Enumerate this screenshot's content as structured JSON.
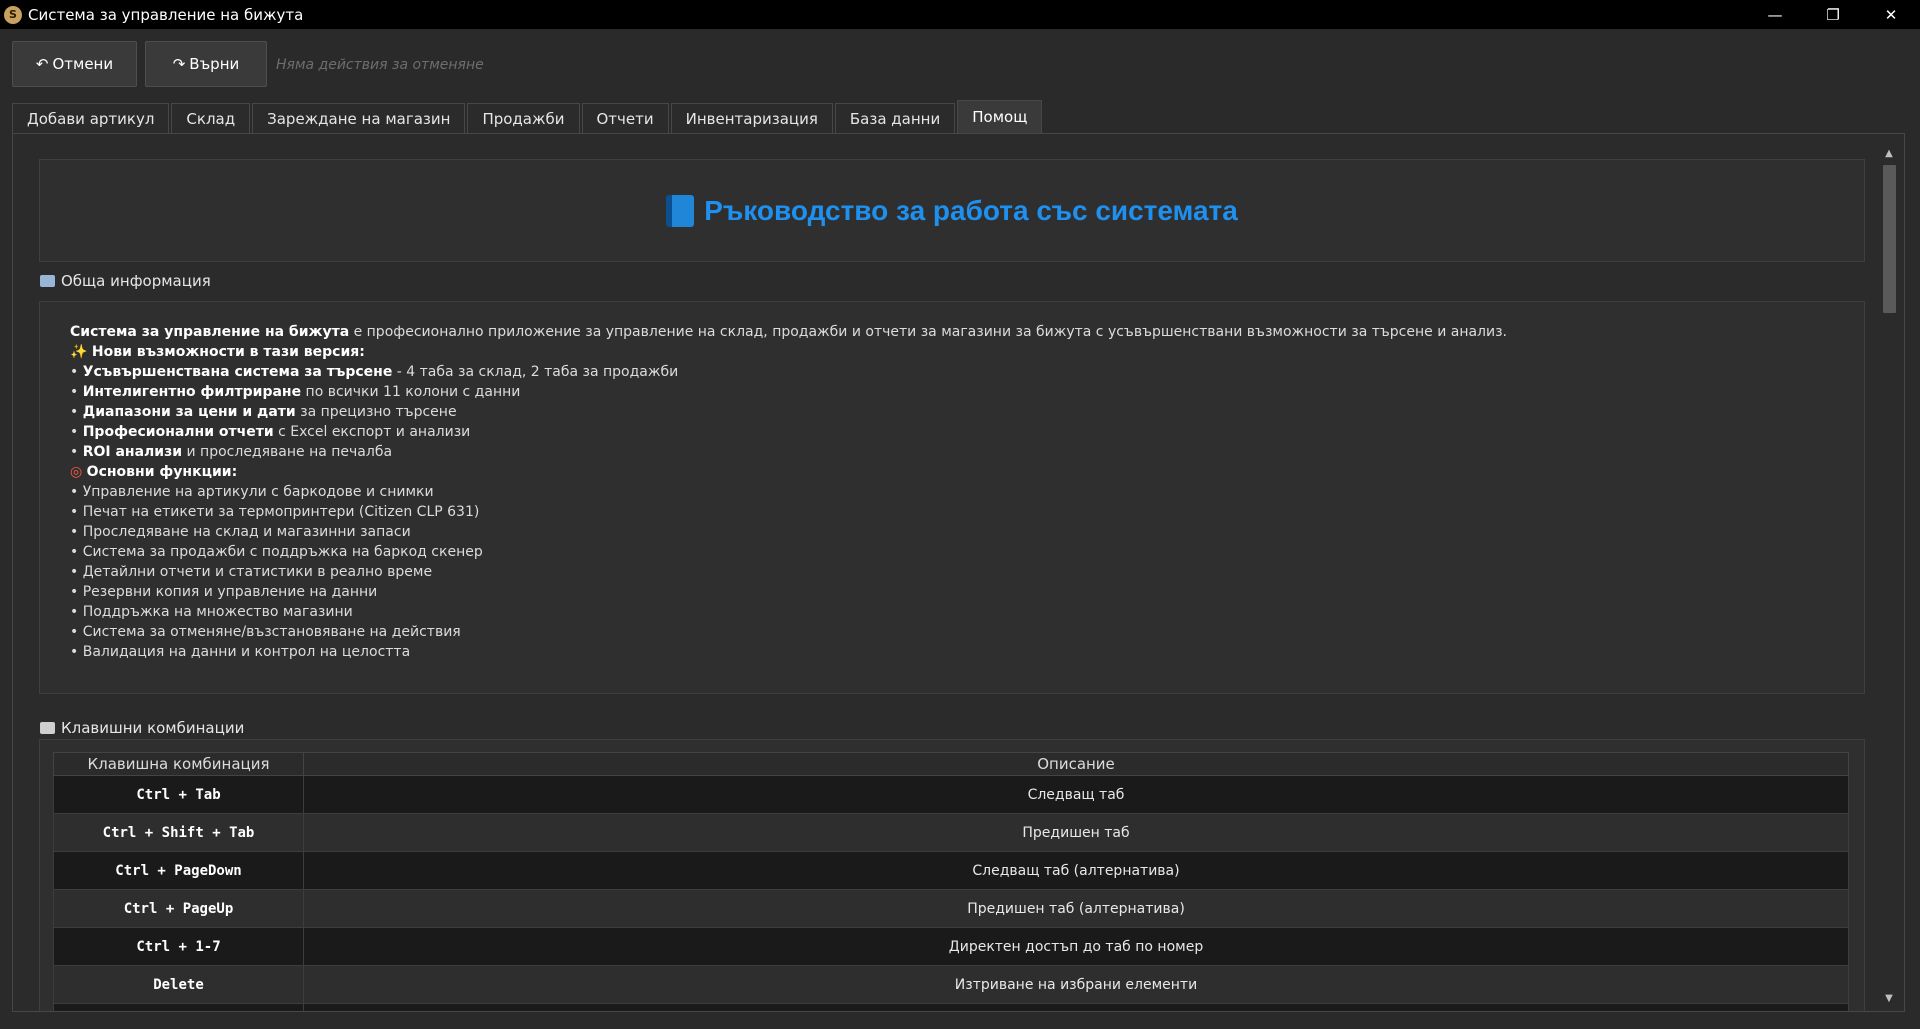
{
  "window": {
    "title": "Система за управление на бижута",
    "minimize": "—",
    "maximize": "❐",
    "close": "✕"
  },
  "toolbar": {
    "undo_icon": "↶",
    "undo_label": "Отмени",
    "redo_icon": "↷",
    "redo_label": "Върни",
    "undo_status": "Няма действия за отменяне"
  },
  "tabs": [
    {
      "label": "Добави артикул"
    },
    {
      "label": "Склад"
    },
    {
      "label": "Зареждане на магазин"
    },
    {
      "label": "Продажби"
    },
    {
      "label": "Отчети"
    },
    {
      "label": "Инвентаризация"
    },
    {
      "label": "База данни"
    },
    {
      "label": "Помощ",
      "active": true
    }
  ],
  "help": {
    "header_title": "Ръководство за работа със системата",
    "general": {
      "label": "Обща информация",
      "intro_bold": "Система за управление на бижута",
      "intro_rest": " е професионално приложение за управление на склад, продажби и отчети за магазини за бижута с усъвършенствани възможности за търсене и анализ.",
      "new_heading": "Нови възможности в тази версия:",
      "new_items": [
        {
          "prefix": "• ",
          "bold": "Усъвършенствана система за търсене",
          "rest": " - 4 таба за склад, 2 таба за продажби"
        },
        {
          "prefix": "• ",
          "bold": "Интелигентно филтриране",
          "rest": " по всички 11 колони с данни"
        },
        {
          "prefix": "• ",
          "bold": "Диапазони за цени и дати",
          "rest": " за прецизно търсене"
        },
        {
          "prefix": "• ",
          "bold": "Професионални отчети",
          "rest": " с Excel експорт и анализи"
        },
        {
          "prefix": "• ",
          "bold": "ROI анализи",
          "rest": " и проследяване на печалба"
        }
      ],
      "main_heading": "Основни функции:",
      "main_items": [
        "• Управление на артикули с баркодове и снимки",
        "• Печат на етикети за термопринтери (Citizen CLP 631)",
        "• Проследяване на склад и магазинни запаси",
        "• Система за продажби с поддръжка на баркод скенер",
        "• Детайлни отчети и статистики в реално време",
        "• Резервни копия и управление на данни",
        "• Поддръжка на множество магазини",
        "• Система за отменяне/възстановяване на действия",
        "• Валидация на данни и контрол на целостта"
      ]
    },
    "shortcuts": {
      "label": "Клавишни комбинации",
      "col_key": "Клавишна комбинация",
      "col_desc": "Описание",
      "rows": [
        {
          "key": "Ctrl + Tab",
          "desc": "Следващ таб"
        },
        {
          "key": "Ctrl + Shift + Tab",
          "desc": "Предишен таб"
        },
        {
          "key": "Ctrl + PageDown",
          "desc": "Следващ таб (алтернатива)"
        },
        {
          "key": "Ctrl + PageUp",
          "desc": "Предишен таб (алтернатива)"
        },
        {
          "key": "Ctrl + 1-7",
          "desc": "Директен достъп до таб по номер"
        },
        {
          "key": "Delete",
          "desc": "Изтриване на избрани елементи"
        }
      ]
    }
  },
  "scrollbar": {
    "up": "▲",
    "down": "▼"
  }
}
